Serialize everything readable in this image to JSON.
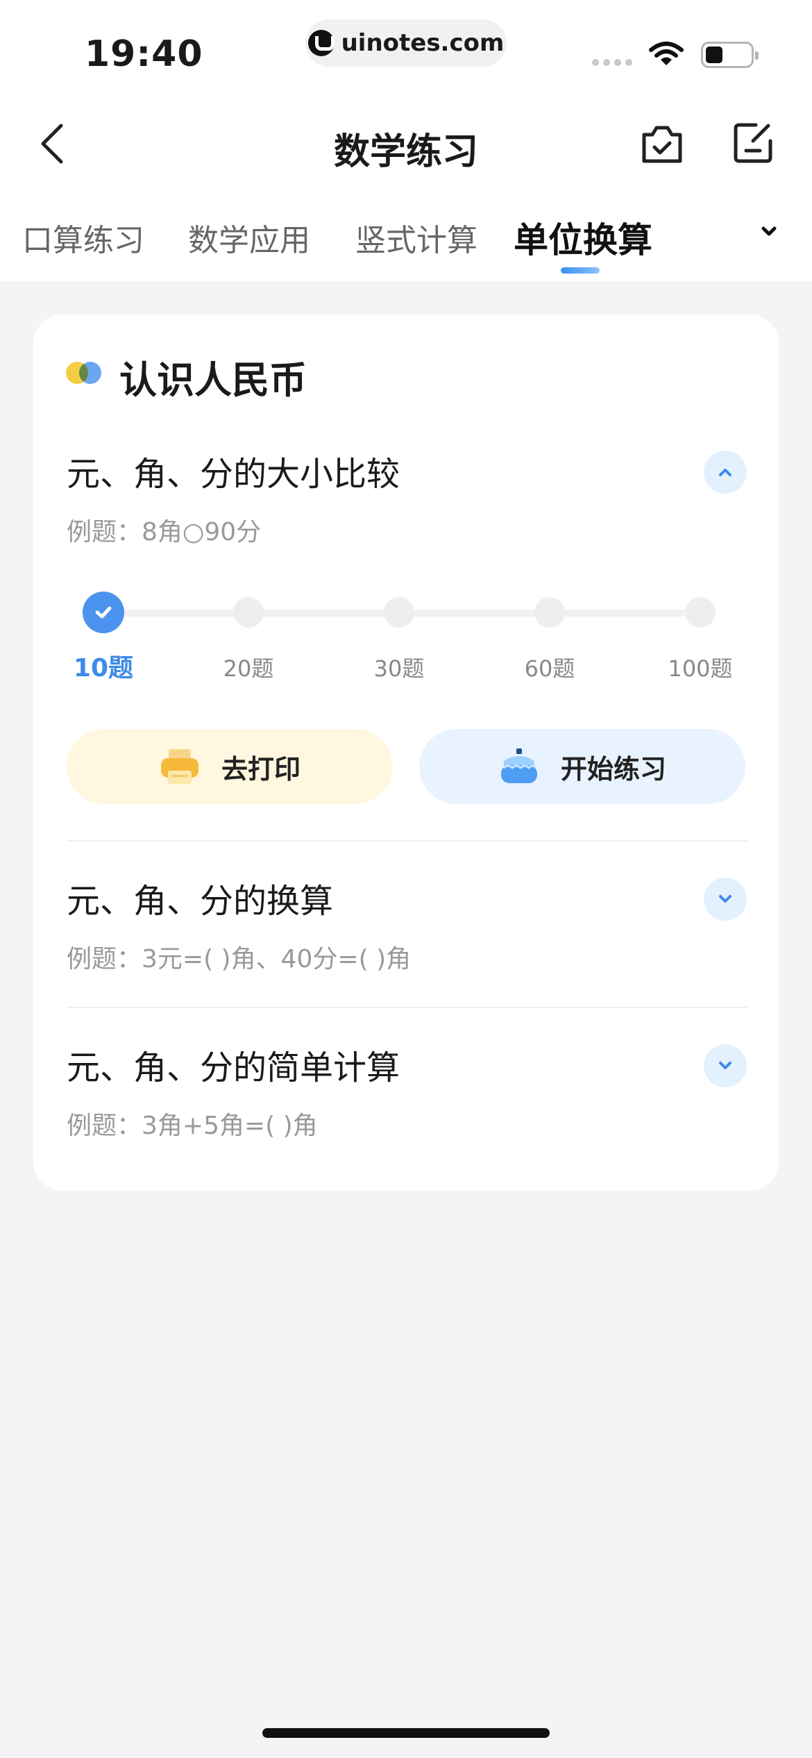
{
  "status_bar": {
    "time": "19:40",
    "url": "uinotes.com"
  },
  "nav": {
    "title": "数学练习"
  },
  "tabs": [
    {
      "label": "口算练习",
      "active": false
    },
    {
      "label": "数学应用",
      "active": false
    },
    {
      "label": "竖式计算",
      "active": false
    },
    {
      "label": "单位换算",
      "active": true
    }
  ],
  "card": {
    "title": "认识人民币",
    "sections": [
      {
        "title": "元、角、分的大小比较",
        "example": "例题：8角○90分",
        "expanded": true,
        "question_counts": [
          "10题",
          "20题",
          "30题",
          "60题",
          "100题"
        ],
        "selected_count": "10题",
        "print_label": "去打印",
        "start_label": "开始练习"
      },
      {
        "title": "元、角、分的换算",
        "example": "例题：3元=(   )角、40分=(   )角",
        "expanded": false
      },
      {
        "title": "元、角、分的简单计算",
        "example": "例题：3角+5角=(   )角",
        "expanded": false
      }
    ]
  },
  "colors": {
    "accent": "#4b93ee",
    "print_bg": "#fff7df",
    "start_bg": "#e9f2ff",
    "page_bg": "#f4f4f4"
  }
}
